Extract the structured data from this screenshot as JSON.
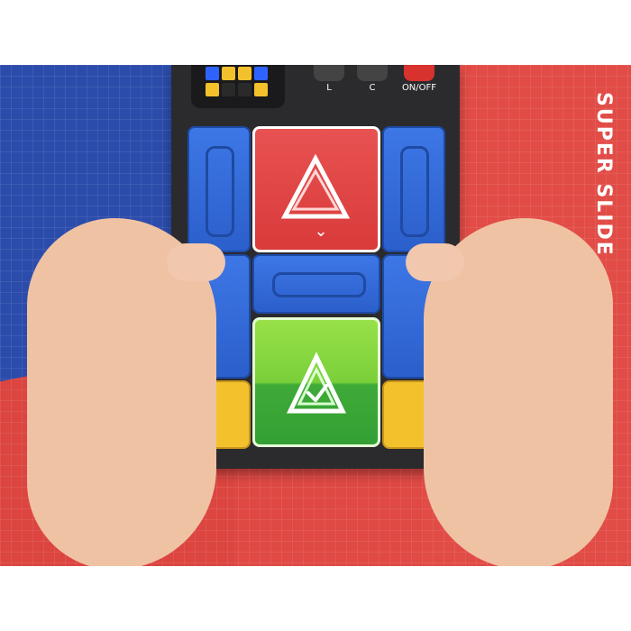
{
  "device": {
    "buttons": [
      {
        "label": "L"
      },
      {
        "label": "C"
      },
      {
        "label": "ON/OFF"
      }
    ]
  },
  "brand": {
    "vertical_text": "SUPER SLIDE"
  },
  "colors": {
    "blue_bg": "#2c4cab",
    "red_bg": "#e24c46",
    "blue_tile": "#3d77e6",
    "yellow_tile": "#f3c12c",
    "red_tile": "#e85252",
    "green_tile": "#7ad03a"
  },
  "icons": {
    "target": "triangle-icon",
    "check": "check-triangle-icon",
    "arrow": "double-chevron-down-icon",
    "logo": "brand-logo-icon"
  }
}
